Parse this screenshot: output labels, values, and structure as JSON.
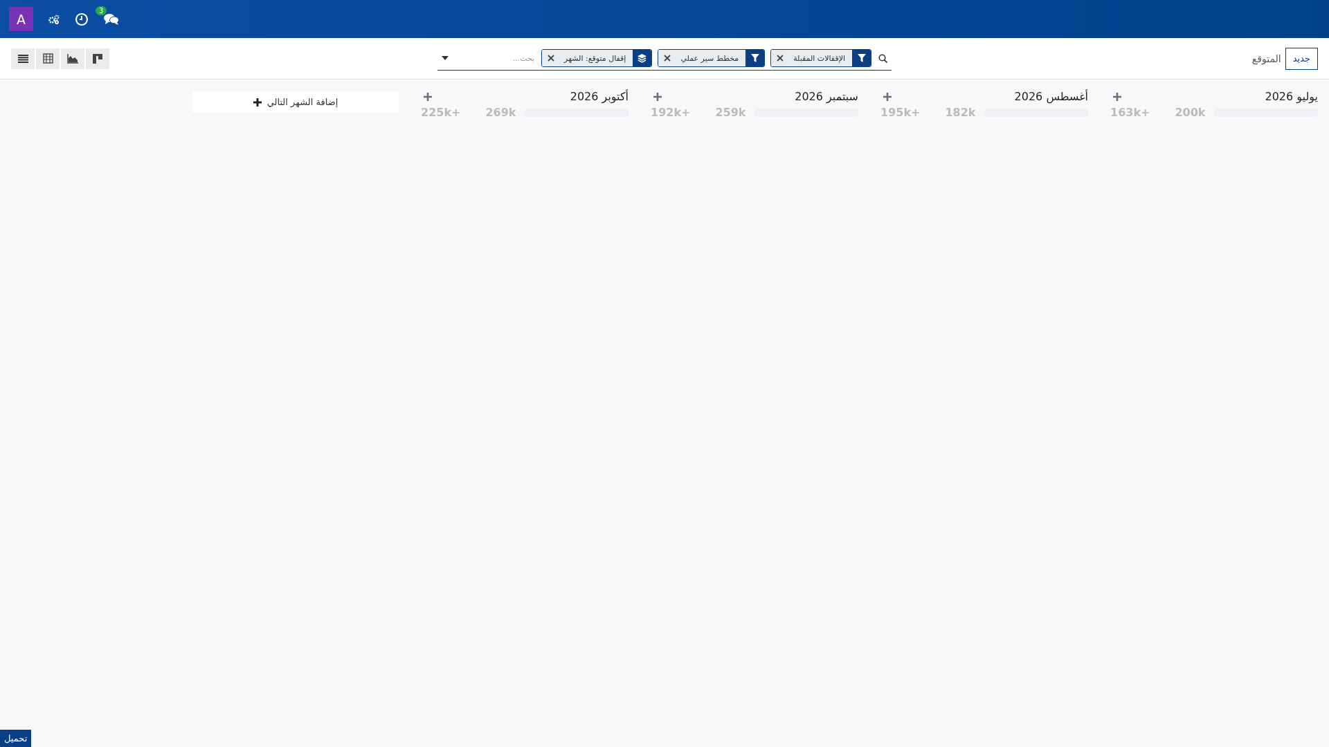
{
  "navbar": {
    "avatar": "A",
    "chat_badge": "3"
  },
  "control_panel": {
    "breadcrumb": "المتوقع",
    "new_button": "جديد",
    "search": {
      "placeholder": "بحث...",
      "facets": [
        {
          "kind": "filter",
          "label": "الإقفالات المقبلة"
        },
        {
          "kind": "filter",
          "label": "مخطط سير عملي"
        },
        {
          "kind": "group",
          "label": "إقفال متوقع: الشهر"
        }
      ]
    },
    "views": [
      {
        "kind": "kanban"
      },
      {
        "kind": "graph"
      },
      {
        "kind": "pivot"
      },
      {
        "kind": "list"
      }
    ]
  },
  "columns": [
    {
      "title": "يوليو 2026",
      "amount": "200k",
      "amount_plus": "163k+",
      "level": 0
    },
    {
      "title": "أغسطس 2026",
      "amount": "182k",
      "amount_plus": "195k+",
      "level": 0
    },
    {
      "title": "سبتمبر 2026",
      "amount": "259k",
      "amount_plus": "192k+",
      "level": 0
    },
    {
      "title": "أكتوبر 2026",
      "amount": "269k",
      "amount_plus": "225k+",
      "level": 0
    }
  ],
  "add_column": "إضافة الشهر التالي",
  "download_button": "تحميل"
}
